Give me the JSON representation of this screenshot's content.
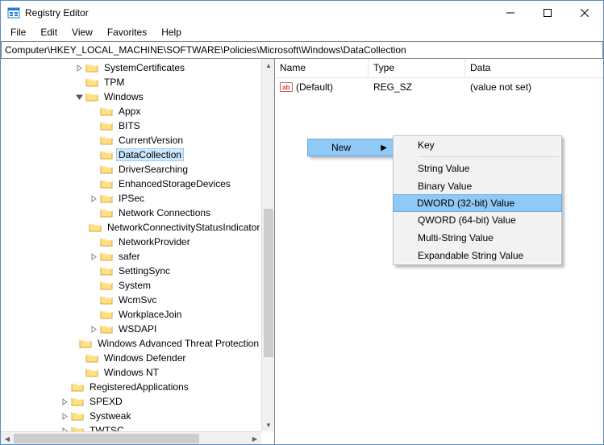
{
  "window": {
    "title": "Registry Editor"
  },
  "menu": {
    "items": [
      "File",
      "Edit",
      "View",
      "Favorites",
      "Help"
    ]
  },
  "address": "Computer\\HKEY_LOCAL_MACHINE\\SOFTWARE\\Policies\\Microsoft\\Windows\\DataCollection",
  "tree_nodes": [
    {
      "indent": 5,
      "expander": "right",
      "label": "SystemCertificates"
    },
    {
      "indent": 5,
      "expander": "none",
      "label": "TPM"
    },
    {
      "indent": 5,
      "expander": "down",
      "label": "Windows"
    },
    {
      "indent": 6,
      "expander": "none",
      "label": "Appx"
    },
    {
      "indent": 6,
      "expander": "none",
      "label": "BITS"
    },
    {
      "indent": 6,
      "expander": "none",
      "label": "CurrentVersion"
    },
    {
      "indent": 6,
      "expander": "none",
      "label": "DataCollection",
      "selected": true
    },
    {
      "indent": 6,
      "expander": "none",
      "label": "DriverSearching"
    },
    {
      "indent": 6,
      "expander": "none",
      "label": "EnhancedStorageDevices"
    },
    {
      "indent": 6,
      "expander": "right",
      "label": "IPSec"
    },
    {
      "indent": 6,
      "expander": "none",
      "label": "Network Connections"
    },
    {
      "indent": 6,
      "expander": "none",
      "label": "NetworkConnectivityStatusIndicator"
    },
    {
      "indent": 6,
      "expander": "none",
      "label": "NetworkProvider"
    },
    {
      "indent": 6,
      "expander": "right",
      "label": "safer"
    },
    {
      "indent": 6,
      "expander": "none",
      "label": "SettingSync"
    },
    {
      "indent": 6,
      "expander": "none",
      "label": "System"
    },
    {
      "indent": 6,
      "expander": "none",
      "label": "WcmSvc"
    },
    {
      "indent": 6,
      "expander": "none",
      "label": "WorkplaceJoin"
    },
    {
      "indent": 6,
      "expander": "right",
      "label": "WSDAPI"
    },
    {
      "indent": 5,
      "expander": "none",
      "label": "Windows Advanced Threat Protection"
    },
    {
      "indent": 5,
      "expander": "none",
      "label": "Windows Defender"
    },
    {
      "indent": 5,
      "expander": "none",
      "label": "Windows NT"
    },
    {
      "indent": 4,
      "expander": "none",
      "label": "RegisteredApplications"
    },
    {
      "indent": 4,
      "expander": "right",
      "label": "SPEXD"
    },
    {
      "indent": 4,
      "expander": "right",
      "label": "Systweak"
    },
    {
      "indent": 4,
      "expander": "right",
      "label": "TWTSC"
    }
  ],
  "list": {
    "columns": [
      "Name",
      "Type",
      "Data"
    ],
    "rows": [
      {
        "name": "(Default)",
        "type": "REG_SZ",
        "data": "(value not set)"
      }
    ]
  },
  "context_primary": {
    "label": "New"
  },
  "context_submenu": [
    {
      "label": "Key",
      "sep_after": true
    },
    {
      "label": "String Value"
    },
    {
      "label": "Binary Value"
    },
    {
      "label": "DWORD (32-bit) Value",
      "highlight": true
    },
    {
      "label": "QWORD (64-bit) Value"
    },
    {
      "label": "Multi-String Value"
    },
    {
      "label": "Expandable String Value"
    }
  ]
}
